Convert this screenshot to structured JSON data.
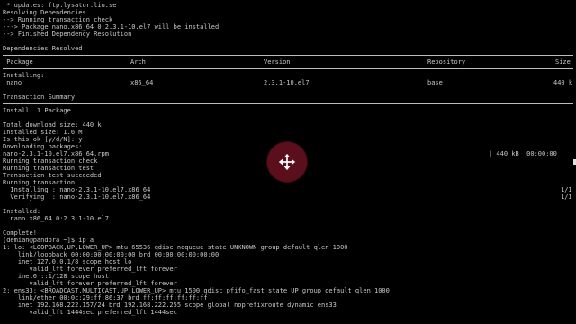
{
  "terminal": {
    "lines_top": [
      " * updates: ftp.lysator.liu.se",
      "Resolving Dependencies",
      "--> Running transaction check",
      "---> Package nano.x86_64 0:2.3.1-10.el7 will be installed",
      "--> Finished Dependency Resolution",
      "",
      "Dependencies Resolved"
    ],
    "table_header": {
      "package": " Package",
      "arch": "Arch",
      "version": "Version",
      "repository": "Repository",
      "size": "Size"
    },
    "installing_label": "Installing:",
    "package_row": {
      "name": " nano",
      "arch": "x86_64",
      "version": "2.3.1-10.el7",
      "repo": "base",
      "size": "440 k"
    },
    "transaction_summary": "Transaction Summary",
    "install_summary": "Install  1 Package",
    "lines_mid": [
      "Total download size: 440 k",
      "Installed size: 1.6 M",
      "Is this ok [y/d/N]: y",
      "Downloading packages:"
    ],
    "download_line": {
      "file": "nano-2.3.1-10.el7.x86_64.rpm",
      "progress": "| 440 kB  00:00:00"
    },
    "lines_tx": [
      "Running transaction check",
      "Running transaction test",
      "Transaction test succeeded",
      "Running transaction"
    ],
    "install_steps": [
      {
        "text": "  Installing : nano-2.3.1-10.el7.x86_64",
        "count": "1/1"
      },
      {
        "text": "  Verifying  : nano-2.3.1-10.el7.x86_64",
        "count": "1/1"
      }
    ],
    "installed_label": "Installed:",
    "installed_pkg": "  nano.x86_64 0:2.3.1-10.el7",
    "complete": "Complete!",
    "prompt": "[demian@pandora ~]$ ip a",
    "ip_output": [
      "1: lo: <LOOPBACK,UP,LOWER_UP> mtu 65536 qdisc noqueue state UNKNOWN group default qlen 1000",
      "    link/loopback 00:00:00:00:00:00 brd 00:00:00:00:00:00",
      "    inet 127.0.0.1/8 scope host lo",
      "       valid_lft forever preferred_lft forever",
      "    inet6 ::1/128 scope host",
      "       valid_lft forever preferred_lft forever",
      "2: ens33: <BROADCAST,MULTICAST,UP,LOWER_UP> mtu 1500 qdisc pfifo_fast state UP group default qlen 1000",
      "    link/ether 00:0c:29:ff:86:37 brd ff:ff:ff:ff:ff:ff",
      "    inet 192.168.222.157/24 brd 192.168.222.255 scope global noprefixroute dynamic ens33",
      "       valid_lft 1444sec preferred_lft 1444sec"
    ]
  },
  "overlay": {
    "icon": "move-cursor-icon",
    "color": "#5b0f1d"
  }
}
